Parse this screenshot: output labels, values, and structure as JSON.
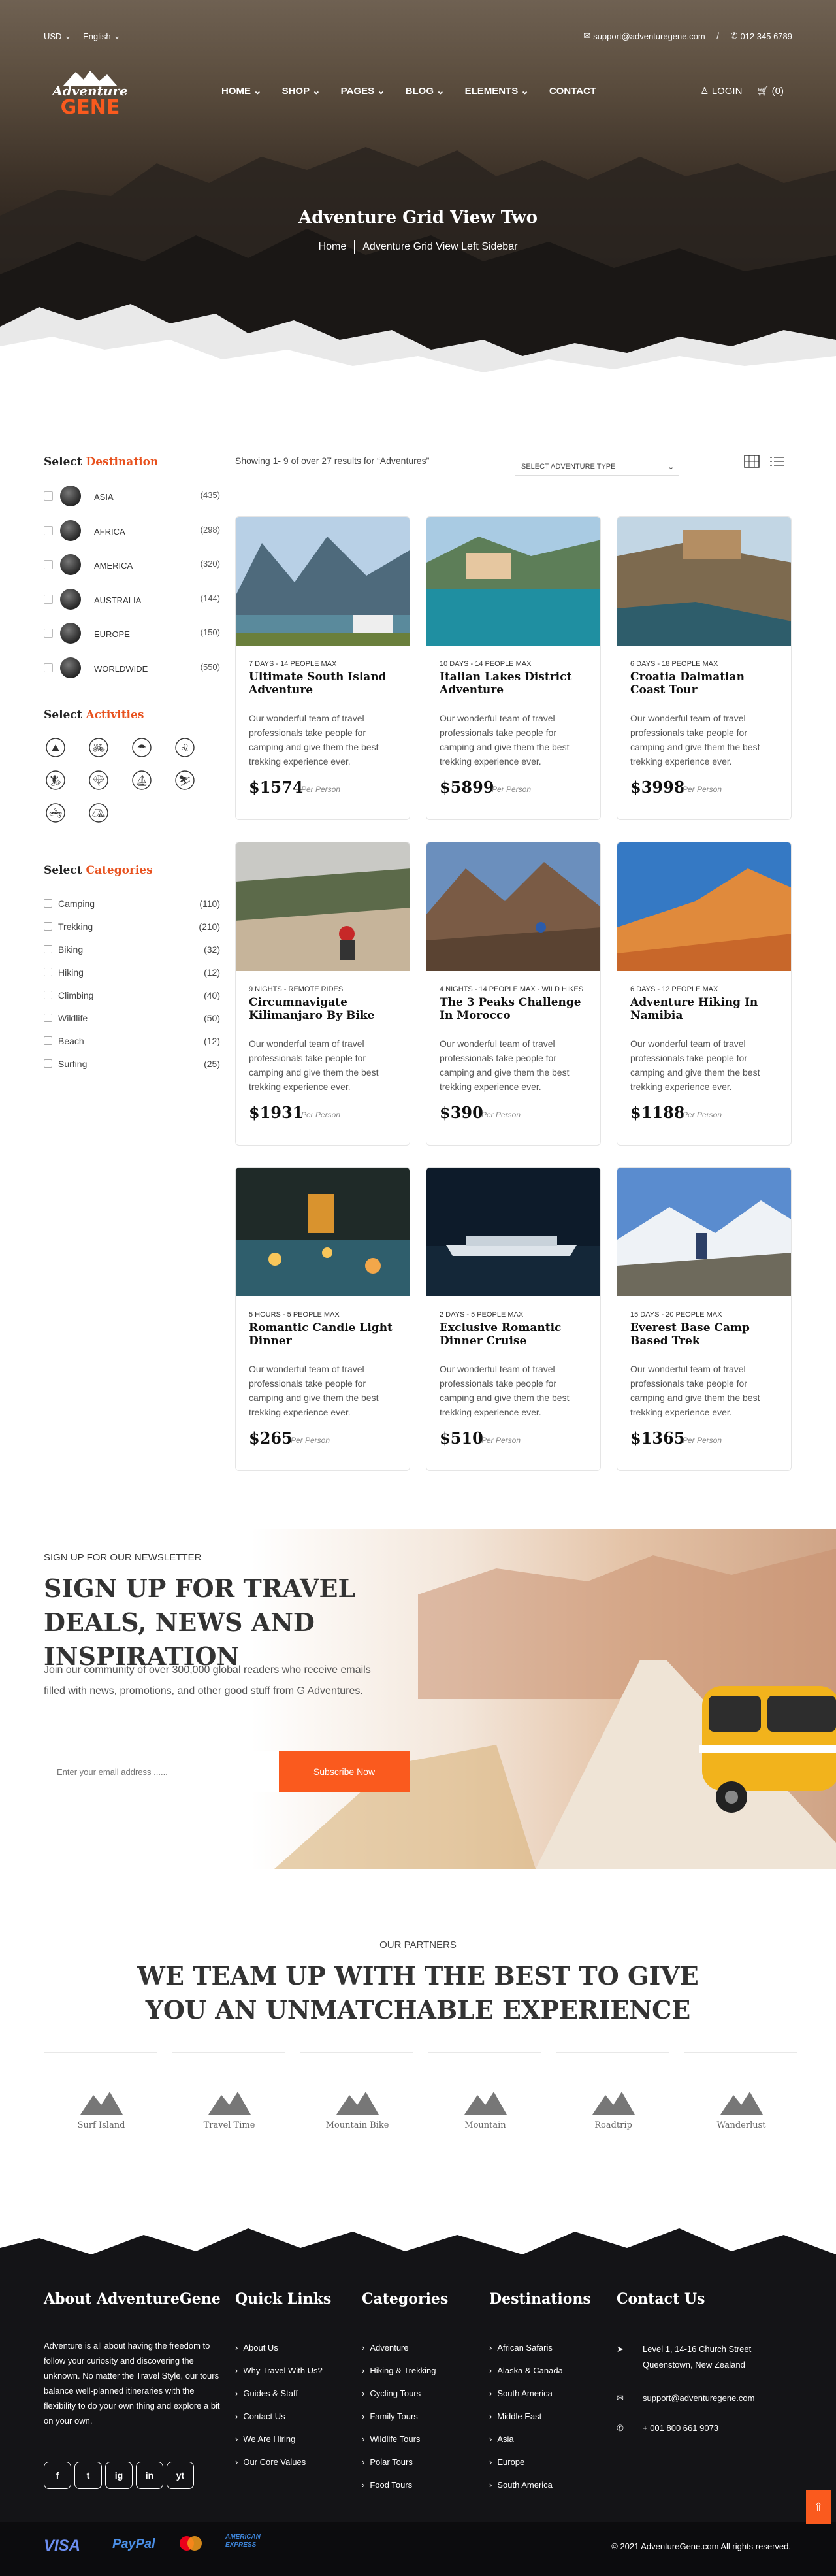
{
  "colors": {
    "accent": "#fa5a1e",
    "dark": "#141417",
    "heading": "#222222"
  },
  "topbar": {
    "currency": "USD",
    "language": "English",
    "email": "support@adventuregene.com",
    "slash": "/",
    "phone": "012 345 6789"
  },
  "logo": {
    "line1": "Adventure",
    "line2": "GENE"
  },
  "nav": {
    "items": [
      "HOME",
      "SHOP",
      "PAGES",
      "BLOG",
      "ELEMENTS",
      "CONTACT"
    ],
    "login": "LOGIN",
    "cart": "(0)"
  },
  "hero": {
    "title": "Adventure Grid View Two",
    "crumb_home": "Home",
    "crumb_current": "Adventure Grid View Left Sidebar"
  },
  "sidebar": {
    "dest_heading_a": "Select",
    "dest_heading_b": "Destination",
    "destinations": [
      {
        "name": "Asia",
        "count": "(435)"
      },
      {
        "name": "Africa",
        "count": "(298)"
      },
      {
        "name": "America",
        "count": "(320)"
      },
      {
        "name": "Australia",
        "count": "(144)"
      },
      {
        "name": "Europe",
        "count": "(150)"
      },
      {
        "name": "Worldwide",
        "count": "(550)"
      }
    ],
    "act_heading_a": "Select",
    "act_heading_b": "Activities",
    "activities": [
      "hiking-icon",
      "cycling-icon",
      "parasailing-icon",
      "lion-icon",
      "surfing-icon",
      "paragliding-icon",
      "rafting-icon",
      "skiing-icon",
      "kayak-icon",
      "camp-icon"
    ],
    "cat_heading_a": "Select",
    "cat_heading_b": "Categories",
    "categories": [
      {
        "name": "Camping",
        "count": "(110)"
      },
      {
        "name": "Trekking",
        "count": "(210)"
      },
      {
        "name": "Biking",
        "count": "(32)"
      },
      {
        "name": "Hiking",
        "count": "(12)"
      },
      {
        "name": "Climbing",
        "count": "(40)"
      },
      {
        "name": "Wildlife",
        "count": "(50)"
      },
      {
        "name": "Beach",
        "count": "(12)"
      },
      {
        "name": "Surfing",
        "count": "(25)"
      }
    ]
  },
  "toolbar": {
    "showing": "Showing 1- 9 of over 27 results for “Adventures”",
    "select": "SELECT ADVENTURE TYPE"
  },
  "cards": [
    {
      "meta": "7 DAYS - 14 PEOPLE MAX",
      "title": "Ultimate South Island Adventure",
      "desc": "Our wonderful team of travel professionals take people for camping and give them the best trekking experience ever.",
      "price": "$1574",
      "per": "Per Person",
      "scene": "fjord"
    },
    {
      "meta": "10 DAYS - 14 PEOPLE MAX",
      "title": "Italian Lakes District Adventure",
      "desc": "Our wonderful team of travel professionals take people for camping and give them the best trekking experience ever.",
      "price": "$5899",
      "per": "Per Person",
      "scene": "lake"
    },
    {
      "meta": "6 DAYS - 18 PEOPLE MAX",
      "title": "Croatia Dalmatian Coast Tour",
      "desc": "Our wonderful team of travel professionals take people for camping and give them the best trekking experience ever.",
      "price": "$3998",
      "per": "Per Person",
      "scene": "coast"
    },
    {
      "meta": "9 NIGHTS - REMOTE RIDES",
      "title": "Circumnavigate Kilimanjaro By Bike",
      "desc": "Our wonderful team of travel professionals take people for camping and give them the best trekking experience ever.",
      "price": "$1931",
      "per": "Per Person",
      "scene": "bike"
    },
    {
      "meta": "4 NIGHTS - 14 PEOPLE MAX - WILD HIKES",
      "title": "The 3 Peaks Challenge In Morocco",
      "desc": "Our wonderful team of travel professionals take people for camping and give them the best trekking experience ever.",
      "price": "$390",
      "per": "Per Person",
      "scene": "peaks"
    },
    {
      "meta": "6 DAYS - 12 PEOPLE MAX",
      "title": "Adventure Hiking In Namibia",
      "desc": "Our wonderful team of travel professionals take people for camping and give them the best trekking experience ever.",
      "price": "$1188",
      "per": "Per Person",
      "scene": "desert"
    },
    {
      "meta": "5 HOURS - 5 PEOPLE MAX",
      "title": "Romantic Candle Light Dinner",
      "desc": "Our wonderful team of travel professionals take people for camping and give them the best trekking experience ever.",
      "price": "$265",
      "per": "Per Person",
      "scene": "candle"
    },
    {
      "meta": "2 DAYS - 5 PEOPLE MAX",
      "title": "Exclusive Romantic Dinner Cruise",
      "desc": "Our wonderful team of travel professionals take people for camping and give them the best trekking experience ever.",
      "price": "$510",
      "per": "Per Person",
      "scene": "cruise"
    },
    {
      "meta": "15 DAYS - 20 PEOPLE MAX",
      "title": "Everest Base Camp Based Trek",
      "desc": "Our wonderful team of travel professionals take people for camping and give them the best trekking experience ever.",
      "price": "$1365",
      "per": "Per Person",
      "scene": "trek"
    }
  ],
  "newsletter": {
    "small": "SIGN UP FOR OUR NEWSLETTER",
    "title": "SIGN UP FOR TRAVEL DEALS, NEWS AND INSPIRATION",
    "text": "Join our community of over 300,000 global readers who receive emails filled with news, promotions, and other good stuff from G Adventures.",
    "placeholder": "Enter your email address ......",
    "button": "Subscribe Now"
  },
  "partners": {
    "small": "OUR PARTNERS",
    "title": "WE TEAM UP WITH THE BEST TO GIVE YOU AN UNMATCHABLE EXPERIENCE",
    "logos": [
      "Surf Island",
      "Travel Time",
      "Mountain Bike",
      "Mountain",
      "Roadtrip",
      "Wanderlust"
    ]
  },
  "footer": {
    "about_title": "About AdventureGene",
    "about": "Adventure is all about having the freedom to follow your curiosity and discovering the unknown. No matter the Travel Style, our tours balance well-planned itineraries with the flexibility to do your own thing and explore a bit on your own.",
    "social": [
      "f",
      "t",
      "ig",
      "in",
      "yt"
    ],
    "quick_title": "Quick Links",
    "quick": [
      "About Us",
      "Why Travel With Us?",
      "Guides & Staff",
      "Contact Us",
      "We Are Hiring",
      "Our Core Values"
    ],
    "cat_title": "Categories",
    "cats": [
      "Adventure",
      "Hiking & Trekking",
      "Cycling Tours",
      "Family Tours",
      "Wildlife Tours",
      "Polar Tours",
      "Food Tours"
    ],
    "dest_title": "Destinations",
    "dests": [
      "African Safaris",
      "Alaska & Canada",
      "South America",
      "Middle East",
      "Asia",
      "Europe",
      "South America"
    ],
    "contact_title": "Contact Us",
    "address1": "Level 1, 14-16 Church Street",
    "address2": "Queenstown, New Zealand",
    "email": "support@adventuregene.com",
    "phone": "+ 001 800 661 9073",
    "pay": [
      "VISA",
      "PayPal",
      "mastercard",
      "AMERICAN EXPRESS"
    ],
    "copyright": "© 2021 AdventureGene.com All rights reserved."
  }
}
